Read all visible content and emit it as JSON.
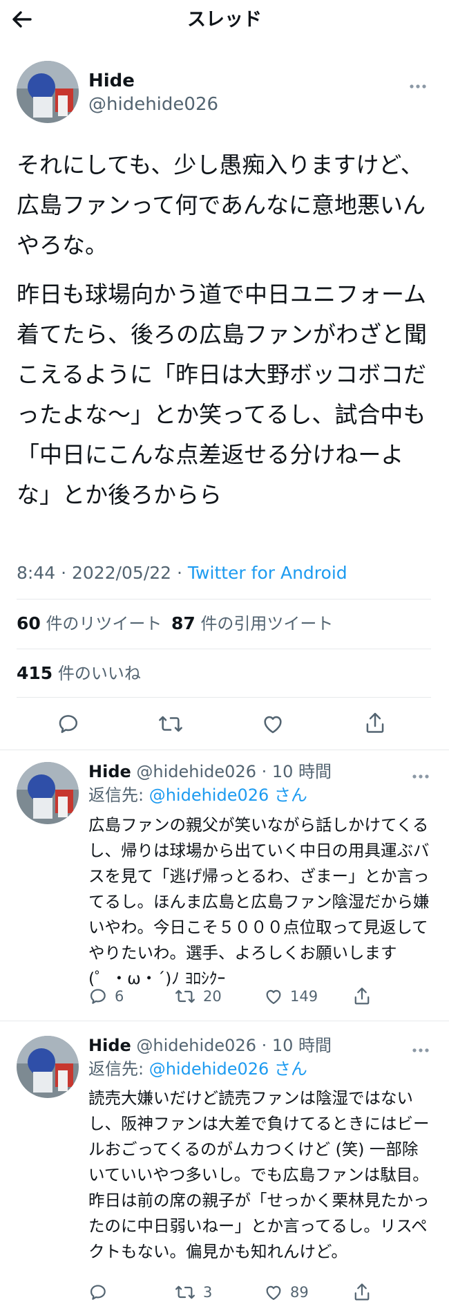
{
  "header": {
    "title": "スレッド"
  },
  "main_tweet": {
    "name": "Hide",
    "handle": "@hidehide026",
    "paragraph1": "それにしても、少し愚痴入りますけど、広島ファンって何であんなに意地悪いんやろな。",
    "paragraph2": "昨日も球場向かう道で中日ユニフォーム着てたら、後ろの広島ファンがわざと聞こえるように「昨日は大野ボッコボコだったよな〜」とか笑ってるし、試合中も「中日にこんな点差返せる分けねーよな」とか後ろからら",
    "time": "8:44 · 2022/05/22 · ",
    "source": "Twitter for Android",
    "retweets_count": "60",
    "retweets_label": "件のリツイート",
    "quotes_count": "87",
    "quotes_label": "件の引用ツイート",
    "likes_count": "415",
    "likes_label": "件のいいね"
  },
  "replies": [
    {
      "name": "Hide",
      "handle_time": " @hidehide026 · 10 時間",
      "reply_prefix": "返信先: ",
      "reply_to": "@hidehide026 さん",
      "text": "広島ファンの親父が笑いながら話しかけてくるし、帰りは球場から出ていく中日の用具運ぶバスを見て「逃げ帰っとるわ、ざまー」とか言ってるし。ほんま広島と広島ファン陰湿だから嫌いやわ。今日こそ５０００点位取って見返してやりたいわ。選手、よろしくお願いします(゜・ω・´)ﾉ ﾖﾛｼｸｰ",
      "replies": "6",
      "retweets": "20",
      "likes": "149"
    },
    {
      "name": "Hide",
      "handle_time": " @hidehide026 · 10 時間",
      "reply_prefix": "返信先: ",
      "reply_to": "@hidehide026 さん",
      "text": "読売大嫌いだけど読売ファンは陰湿ではないし、阪神ファンは大差で負けてるときにはビールおごってくるのがムカつくけど (笑) 一部除いていいやつ多いし。でも広島ファンは駄目。昨日は前の席の親子が「せっかく栗林見たかったのに中日弱いねー」とか言ってるし。リスペクトもない。偏見かも知れんけど。",
      "replies": "",
      "retweets": "3",
      "likes": "89"
    }
  ],
  "icons": {
    "back": "arrow-left-icon",
    "more": "more-horizontal-icon",
    "reply": "speech-bubble-icon",
    "retweet": "retweet-icon",
    "like": "heart-icon",
    "share": "share-icon"
  },
  "colors": {
    "link": "#1d9bf0",
    "secondary": "#536471",
    "divider": "#e6e9eb"
  }
}
